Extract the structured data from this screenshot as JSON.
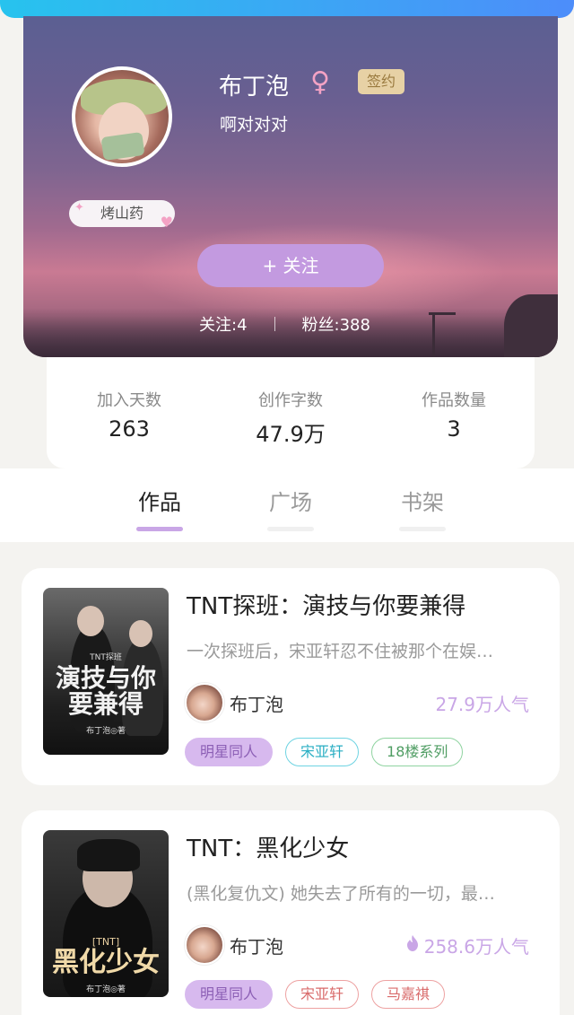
{
  "profile": {
    "name": "布丁泡",
    "gender_symbol": "♀",
    "sign_badge": "签约",
    "bio": "啊对对对",
    "level_badge": "烤山药",
    "follow_button": "+ 关注",
    "following_label": "关注:",
    "following_count": "4",
    "fans_label": "粉丝:",
    "fans_count": "388"
  },
  "stats": [
    {
      "label": "加入天数",
      "value": "263"
    },
    {
      "label": "创作字数",
      "value": "47.9万"
    },
    {
      "label": "作品数量",
      "value": "3"
    }
  ],
  "tabs": [
    {
      "label": "作品",
      "active": true
    },
    {
      "label": "广场",
      "active": false
    },
    {
      "label": "书架",
      "active": false
    }
  ],
  "books": [
    {
      "title": "TNT探班：演技与你要兼得",
      "description": "一次探班后，宋亚轩忍不住被那个在娱…",
      "author": "布丁泡",
      "popularity": "27.9万人气",
      "show_fire_icon": false,
      "cover_text": "演技与你要兼得",
      "cover_small_top": "TNT探班",
      "cover_small_bottom": "布丁泡◎著",
      "tags": [
        {
          "label": "明星同人",
          "style": "purple"
        },
        {
          "label": "宋亚轩",
          "style": "cyan"
        },
        {
          "label": "18楼系列",
          "style": "green"
        }
      ]
    },
    {
      "title": "TNT：黑化少女",
      "description": "(黑化复仇文) 她失去了所有的一切，最…",
      "author": "布丁泡",
      "popularity": "258.6万人气",
      "show_fire_icon": true,
      "cover_text": "黑化少女",
      "cover_small_top": "[TNT]",
      "cover_small_bottom": "布丁泡◎著",
      "tags": [
        {
          "label": "明星同人",
          "style": "purple"
        },
        {
          "label": "宋亚轩",
          "style": "red"
        },
        {
          "label": "马嘉祺",
          "style": "red"
        }
      ]
    }
  ],
  "colors": {
    "accent_purple": "#c39ae0",
    "tab_indicator": "#c9a6e6",
    "top_strip_start": "#27c3ee",
    "top_strip_end": "#4d8dfa"
  },
  "icons": {
    "gender": "female-symbol-icon",
    "popularity": "fire-icon"
  }
}
